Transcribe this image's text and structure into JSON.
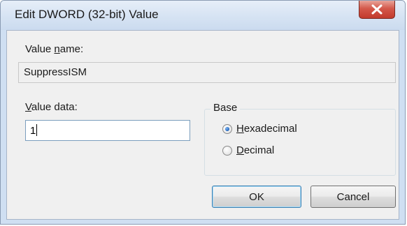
{
  "window": {
    "title": "Edit DWORD (32-bit) Value"
  },
  "value_name": {
    "label_pre": "Value ",
    "label_accel": "n",
    "label_post": "ame:",
    "value": "SuppressISM"
  },
  "value_data": {
    "label_accel": "V",
    "label_post": "alue data:",
    "value": "1"
  },
  "base": {
    "title": "Base",
    "options": [
      {
        "accel": "H",
        "rest": "exadecimal",
        "checked": true
      },
      {
        "accel": "D",
        "rest": "ecimal",
        "checked": false
      }
    ]
  },
  "buttons": {
    "ok": "OK",
    "cancel": "Cancel"
  },
  "colors": {
    "accent": "#2b6fc5",
    "close": "#c23b2d"
  },
  "icons": {
    "close": "close-icon"
  }
}
